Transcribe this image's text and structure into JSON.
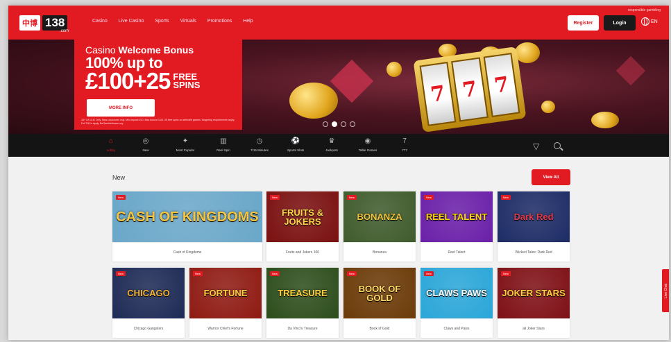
{
  "header": {
    "logo_chinese": "中博",
    "logo_number": "138",
    "logo_suffix": ".com",
    "nav": [
      "Casino",
      "Live Casino",
      "Sports",
      "Virtuals",
      "Promotions",
      "Help"
    ],
    "responsible_link": "responsible gambling",
    "register_label": "Register",
    "login_label": "Login",
    "language": "EN",
    "brand_color": "#e21b23"
  },
  "hero": {
    "promo_prefix": "Casino ",
    "promo_prefix_bold": "Welcome Bonus",
    "promo_line2": "100% up to",
    "promo_amount": "£100+25",
    "promo_free": "FREE",
    "promo_spins": "SPINS",
    "button_label": "MORE INFO",
    "terms": "18+ UK & IE Only. New customers only. Min deposit £20. Max bonus £100. 25 free spins on selected games. Wagering requirements apply. Full T&Cs apply. BeGambleAware.org",
    "slot_reels": [
      "7",
      "7",
      "7"
    ],
    "slide_count": 4,
    "active_slide": 1
  },
  "categories": [
    {
      "label": "Lobby",
      "icon": "home-icon",
      "glyph": "⌂",
      "active": true
    },
    {
      "label": "New",
      "icon": "new-icon",
      "glyph": "◎",
      "active": false
    },
    {
      "label": "Most Popular",
      "icon": "star-icon",
      "glyph": "✦",
      "active": false
    },
    {
      "label": "Reel Spin",
      "icon": "slot-icon",
      "glyph": "▥",
      "active": false
    },
    {
      "label": "7/15 Minutes",
      "icon": "clock-icon",
      "glyph": "◷",
      "active": false
    },
    {
      "label": "Sports Slots",
      "icon": "ball-icon",
      "glyph": "⚽",
      "active": false
    },
    {
      "label": "Jackpots",
      "icon": "jackpot-icon",
      "glyph": "♛",
      "active": false
    },
    {
      "label": "Table Games",
      "icon": "chip-icon",
      "glyph": "◉",
      "active": false
    },
    {
      "label": "777",
      "icon": "seven-icon",
      "glyph": "7",
      "active": false
    }
  ],
  "section": {
    "title": "New",
    "view_all_label": "View All"
  },
  "games": [
    {
      "name": "Cash of Kingdoms",
      "art": "CASH OF KINGDOMS",
      "badge": "New",
      "bg": "#6aa7c9",
      "fg": "#f3c542"
    },
    {
      "name": "Fruits and Jokers 100",
      "art": "FRUITS & JOKERS",
      "badge": "New",
      "bg": "#7a1010",
      "fg": "#ffd24a"
    },
    {
      "name": "Bonanza",
      "art": "BONANZA",
      "badge": "New",
      "bg": "#3f5b2c",
      "fg": "#f0c23a"
    },
    {
      "name": "Reel Talent",
      "art": "REEL TALENT",
      "badge": "New",
      "bg": "#6a1fa8",
      "fg": "#ffd700"
    },
    {
      "name": "Wicked Tales: Dark Red",
      "art": "Dark Red",
      "badge": "New",
      "bg": "#1d2b66",
      "fg": "#e23a4a"
    },
    {
      "name": "Chicago Gangsters",
      "art": "CHICAGO",
      "badge": "New",
      "bg": "#1d2a55",
      "fg": "#f2b233"
    },
    {
      "name": "Warrior Chief's Fortune",
      "art": "FORTUNE",
      "badge": "New",
      "bg": "#8e1a12",
      "fg": "#ffce3a"
    },
    {
      "name": "Da Vinci's Treasure",
      "art": "TREASURE",
      "badge": "New",
      "bg": "#2d4d1c",
      "fg": "#ffcd3c"
    },
    {
      "name": "Book of Gold",
      "art": "BOOK OF GOLD",
      "badge": "New",
      "bg": "#6b3a08",
      "fg": "#ffd966"
    },
    {
      "name": "Claws and Paws",
      "art": "CLAWS PAWS",
      "badge": "New",
      "bg": "#2aa6d8",
      "fg": "#ffffff"
    },
    {
      "name": "all Joker Stars",
      "art": "JOKER STARS",
      "badge": "New",
      "bg": "#7e1016",
      "fg": "#ffcf3a"
    }
  ],
  "live_chat_label": "Live Chat"
}
